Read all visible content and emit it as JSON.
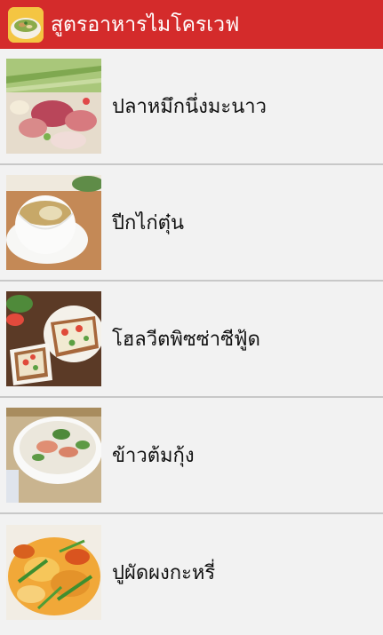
{
  "app": {
    "title": "สูตรอาหารไมโครเวฟ",
    "icon": "bowl-of-food-icon"
  },
  "colors": {
    "app_bar": "#d42b2b",
    "background": "#f2f2f2",
    "divider": "#c8c8c8"
  },
  "recipes": [
    {
      "label": "ปลาหมึกนึ่งมะนาว",
      "thumbnail": "steamed-squid-lime-photo"
    },
    {
      "label": "ปีกไก่ตุ๋น",
      "thumbnail": "stewed-chicken-wings-photo"
    },
    {
      "label": "โฮลวีตพิซซ่าซีฟู้ด",
      "thumbnail": "wholewheat-seafood-pizza-photo"
    },
    {
      "label": "ข้าวต้มกุ้ง",
      "thumbnail": "shrimp-rice-soup-photo"
    },
    {
      "label": "ปูผัดผงกะหรี่",
      "thumbnail": "curry-crab-photo"
    }
  ]
}
